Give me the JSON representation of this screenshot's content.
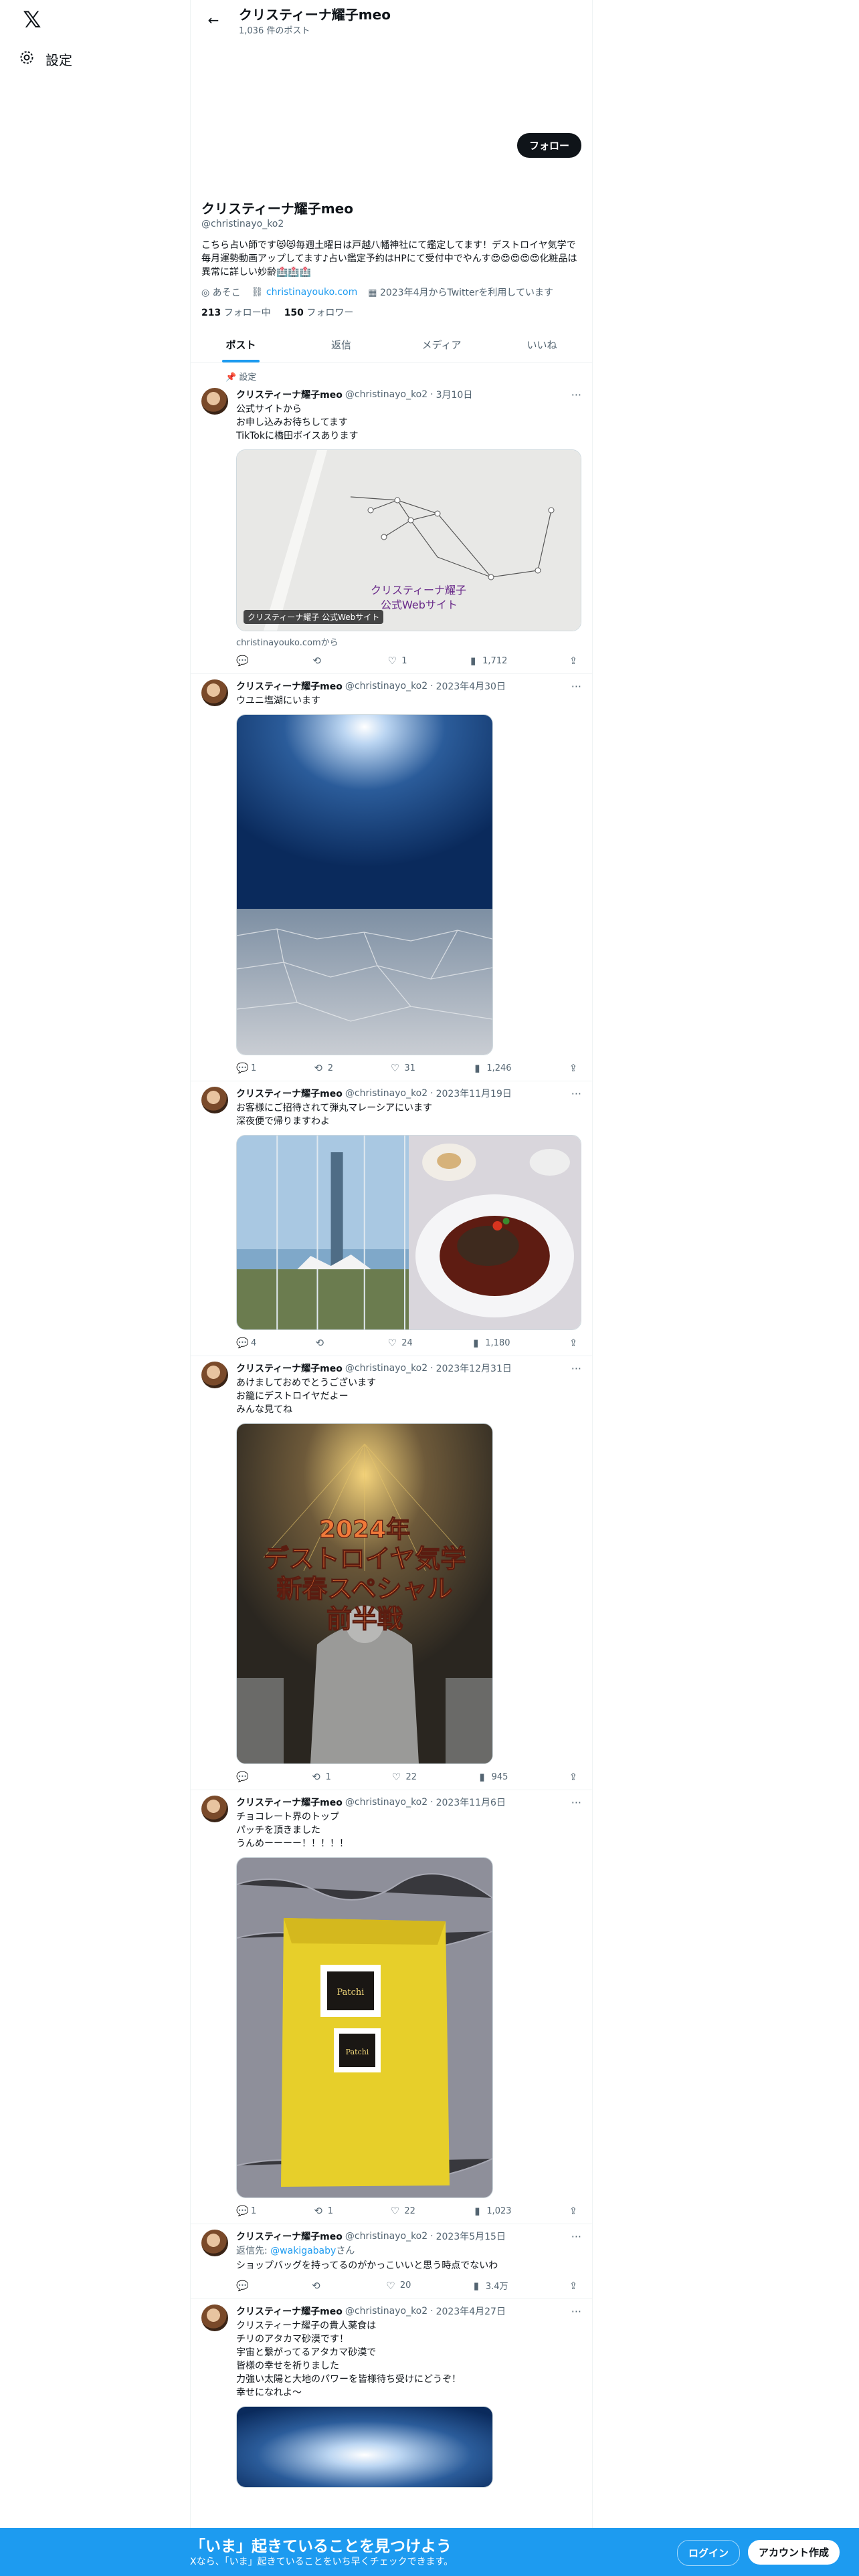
{
  "nav": {
    "settings_label": "設定",
    "logo_text": "𝕏"
  },
  "header": {
    "title": "クリスティーナ耀子meo",
    "post_count": "1,036 件のポスト"
  },
  "profile": {
    "follow_label": "フォロー",
    "name": "クリスティーナ耀子meo",
    "handle": "@christinayo_ko2",
    "bio": "こちら占い師です😻😻毎週土曜日は戸越八幡神社にて鑑定してます！デストロイヤ気学で毎月運勢動画アップしてます♪占い鑑定予約はHPにて受付中でやんす😍😍😍😍😍化粧品は異常に詳しい妙齢🏥🏥🏥",
    "location": "あそこ",
    "website": "christinayouko.com",
    "joined": "2023年4月からTwitterを利用しています",
    "following_count": "213",
    "following_label": "フォロー中",
    "followers_count": "150",
    "followers_label": "フォロワー"
  },
  "tabs": [
    "ポスト",
    "返信",
    "メディア",
    "いいね"
  ],
  "pinned_label": "設定",
  "tweets": [
    {
      "name": "クリスティーナ耀子meo",
      "handle": "@christinayo_ko2",
      "date": "3月10日",
      "text": "公式サイトから\nお申し込みお待ちしてます\nTikTokに橋田ボイスあります",
      "card_label": "クリスティーナ耀子 公式Webサイト",
      "card_overlay": "クリスティーナ耀子\n公式Webサイト",
      "card_source": "christinayouko.comから",
      "replies": "",
      "retweets": "",
      "likes": "1",
      "views": "1,712"
    },
    {
      "name": "クリスティーナ耀子meo",
      "handle": "@christinayo_ko2",
      "date": "2023年4月30日",
      "text": "ウユニ塩湖にいます",
      "replies": "1",
      "retweets": "2",
      "likes": "31",
      "views": "1,246"
    },
    {
      "name": "クリスティーナ耀子meo",
      "handle": "@christinayo_ko2",
      "date": "2023年11月19日",
      "text": "お客様にご招待されて弾丸マレーシアにいます\n深夜便で帰りますわよ",
      "replies": "4",
      "retweets": "",
      "likes": "24",
      "views": "1,180"
    },
    {
      "name": "クリスティーナ耀子meo",
      "handle": "@christinayo_ko2",
      "date": "2023年12月31日",
      "text": "あけましておめでとうございます\nお籠にデストロイヤだよー\nみんな見てね",
      "poster_lines": [
        "2024年",
        "デストロイヤ気学",
        "新春スペシャル",
        "前半戦"
      ],
      "replies": "",
      "retweets": "1",
      "likes": "22",
      "views": "945"
    },
    {
      "name": "クリスティーナ耀子meo",
      "handle": "@christinayo_ko2",
      "date": "2023年11月6日",
      "text": "チョコレート界のトップ\nパッチを頂きました\nうんめーーーー！！！！！",
      "brand": "Patchi",
      "replies": "1",
      "retweets": "1",
      "likes": "22",
      "views": "1,023"
    },
    {
      "name": "クリスティーナ耀子meo",
      "handle": "@christinayo_ko2",
      "date": "2023年5月15日",
      "reply_prefix": "返信先: ",
      "reply_to": "@wakigababy",
      "reply_suffix": "さん",
      "text": "ショップバッグを持ってるのがかっこいいと思う時点でないわ",
      "replies": "",
      "retweets": "",
      "likes": "20",
      "views": "3.4万"
    },
    {
      "name": "クリスティーナ耀子meo",
      "handle": "@christinayo_ko2",
      "date": "2023年4月27日",
      "text": "クリスティーナ耀子の貴人薬食は\nチリのアタカマ砂漠です！\n宇宙と繋がってるアタカマ砂漠で\n皆様の幸せを祈りました\n力強い太陽と大地のパワーを皆様待ち受けにどうぞ！\n幸せになれよ〜"
    }
  ],
  "bottom_bar": {
    "title": "「いま」起きていることを見つけよう",
    "subtitle": "Xなら、「いま」起きていることをいち早くチェックできます。",
    "login_label": "ログイン",
    "signup_label": "アカウント作成"
  }
}
